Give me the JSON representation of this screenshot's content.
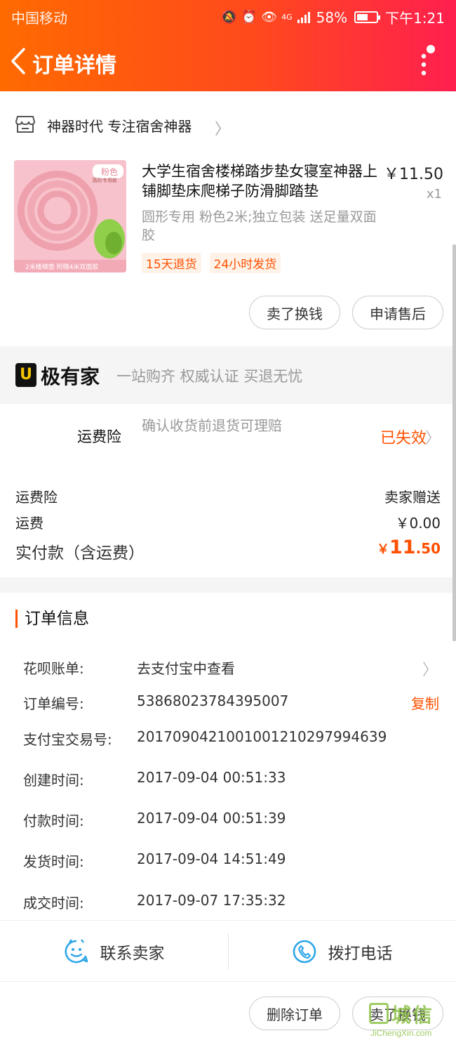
{
  "status_bar": {
    "carrier": "中国移动",
    "signal_label": "4G",
    "battery": "58%",
    "battery_level": 0.58,
    "time": "下午1:21"
  },
  "header": {
    "title": "订单详情",
    "back_icon": "chevron-left-icon",
    "more_icon": "more-vertical-icon"
  },
  "shop": {
    "name": "神器时代 专注宿舍神器",
    "icon": "store-icon"
  },
  "product": {
    "thumb_badge": "粉色",
    "thumb_sub": "圆形专用款",
    "thumb_caption": "2米楼梯垫 附赠4米双面胶",
    "title": "大学生宿舍楼梯踏步垫女寝室神器上铺脚垫床爬梯子防滑脚踏垫",
    "price": "￥11.50",
    "quantity": "x1",
    "spec": "圆形专用 粉色2米;独立包装 送足量双面胶",
    "tags": [
      "15天退货",
      "24小时发货"
    ]
  },
  "item_actions": {
    "sell_exchange": "卖了换钱",
    "after_sales": "申请售后"
  },
  "jiyoujia": {
    "logo_char": "U",
    "brand": "极有家",
    "slogan": "一站购齐 权威认证 买退无忧"
  },
  "insurance": {
    "label": "运费险",
    "desc": "确认收货前退货可理赔",
    "status": "已失效"
  },
  "fees": {
    "insurance_label": "运费险",
    "insurance_value": "卖家赠送",
    "shipping_label": "运费",
    "shipping_value": "￥0.00",
    "total_label": "实付款（含运费）",
    "total_symbol": "￥",
    "total_int": "11",
    "total_dec": ".50"
  },
  "order_info": {
    "title": "订单信息",
    "rows": [
      {
        "label": "花呗账单:",
        "value": "去支付宝中查看"
      },
      {
        "label": "订单编号:",
        "value": "53868023784395007"
      },
      {
        "label": "支付宝交易号:",
        "value": "2017090421001001210297994639"
      },
      {
        "label": "创建时间:",
        "value": "2017-09-04 00:51:33"
      },
      {
        "label": "付款时间:",
        "value": "2017-09-04 00:51:39"
      },
      {
        "label": "发货时间:",
        "value": "2017-09-04 14:51:49"
      },
      {
        "label": "成交时间:",
        "value": "2017-09-07 17:35:32"
      }
    ],
    "copy_label": "复制"
  },
  "contact": {
    "seller": "联系卖家",
    "call": "拨打电话"
  },
  "bottom_actions": {
    "delete_order": "删除订单",
    "sell_exchange": "卖了换钱"
  },
  "watermark": {
    "main": "城信",
    "sub": "JiChengXin.com"
  },
  "colors": {
    "accent": "#ff5000",
    "header_start": "#ff6a00",
    "header_end": "#ff1f4f",
    "muted": "#999999"
  }
}
